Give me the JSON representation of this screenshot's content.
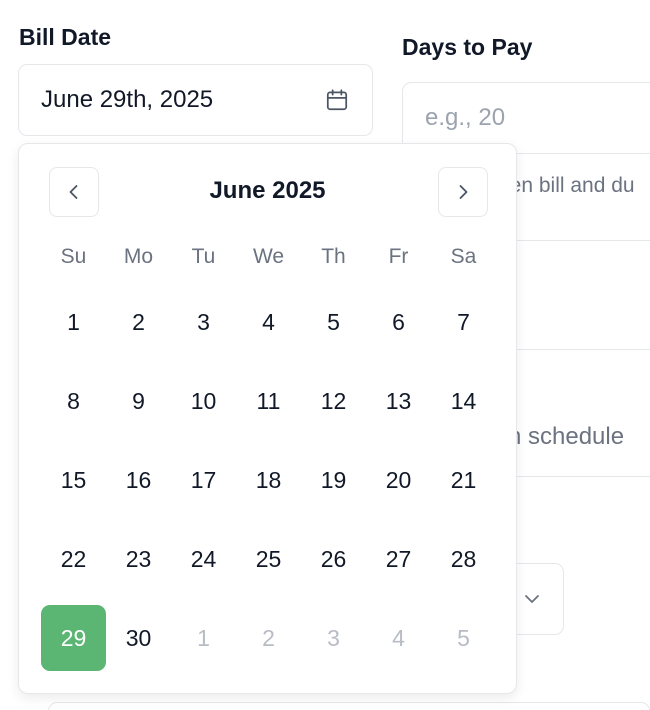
{
  "bill_date": {
    "label": "Bill Date",
    "value": "June 29th, 2025",
    "icon": "calendar-icon"
  },
  "days_to_pay": {
    "label": "Days to Pay",
    "placeholder": "e.g., 20",
    "help_text_fragment": "een bill and du"
  },
  "schedule_fragment": "n schedule",
  "calendar": {
    "month_title": "June 2025",
    "prev_icon": "chevron-left-icon",
    "next_icon": "chevron-right-icon",
    "weekdays": [
      "Su",
      "Mo",
      "Tu",
      "We",
      "Th",
      "Fr",
      "Sa"
    ],
    "days": [
      {
        "label": "1"
      },
      {
        "label": "2"
      },
      {
        "label": "3"
      },
      {
        "label": "4"
      },
      {
        "label": "5"
      },
      {
        "label": "6"
      },
      {
        "label": "7"
      },
      {
        "label": "8"
      },
      {
        "label": "9"
      },
      {
        "label": "10"
      },
      {
        "label": "11"
      },
      {
        "label": "12"
      },
      {
        "label": "13"
      },
      {
        "label": "14"
      },
      {
        "label": "15"
      },
      {
        "label": "16"
      },
      {
        "label": "17"
      },
      {
        "label": "18"
      },
      {
        "label": "19"
      },
      {
        "label": "20"
      },
      {
        "label": "21"
      },
      {
        "label": "22"
      },
      {
        "label": "23"
      },
      {
        "label": "24"
      },
      {
        "label": "25"
      },
      {
        "label": "26"
      },
      {
        "label": "27"
      },
      {
        "label": "28"
      },
      {
        "label": "29",
        "selected": true
      },
      {
        "label": "30"
      },
      {
        "label": "1",
        "outside": true
      },
      {
        "label": "2",
        "outside": true
      },
      {
        "label": "3",
        "outside": true
      },
      {
        "label": "4",
        "outside": true
      },
      {
        "label": "5",
        "outside": true
      }
    ],
    "selected_color": "#5bb573"
  }
}
